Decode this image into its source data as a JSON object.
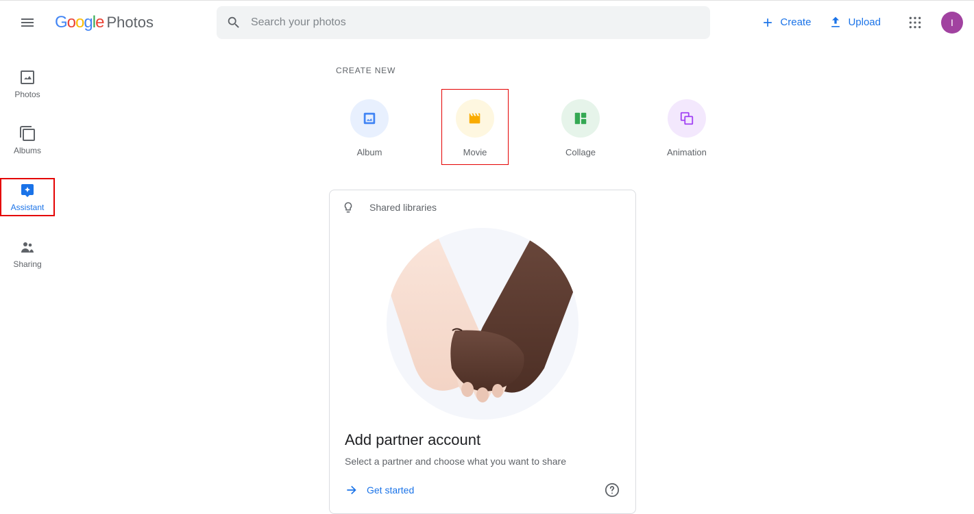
{
  "header": {
    "logo_product": "Photos",
    "search_placeholder": "Search your photos",
    "create_btn": "Create",
    "upload_btn": "Upload",
    "avatar_initial": "I"
  },
  "nav": {
    "items": [
      {
        "id": "photos",
        "label": "Photos",
        "active": false
      },
      {
        "id": "albums",
        "label": "Albums",
        "active": false
      },
      {
        "id": "assistant",
        "label": "Assistant",
        "active": true
      },
      {
        "id": "sharing",
        "label": "Sharing",
        "active": false
      }
    ]
  },
  "create": {
    "section_label": "CREATE NEW",
    "items": [
      {
        "id": "album",
        "label": "Album"
      },
      {
        "id": "movie",
        "label": "Movie"
      },
      {
        "id": "collage",
        "label": "Collage"
      },
      {
        "id": "animation",
        "label": "Animation"
      }
    ]
  },
  "shared_card": {
    "badge": "Shared libraries",
    "title": "Add partner account",
    "subtitle": "Select a partner and choose what you want to share",
    "cta": "Get started"
  }
}
